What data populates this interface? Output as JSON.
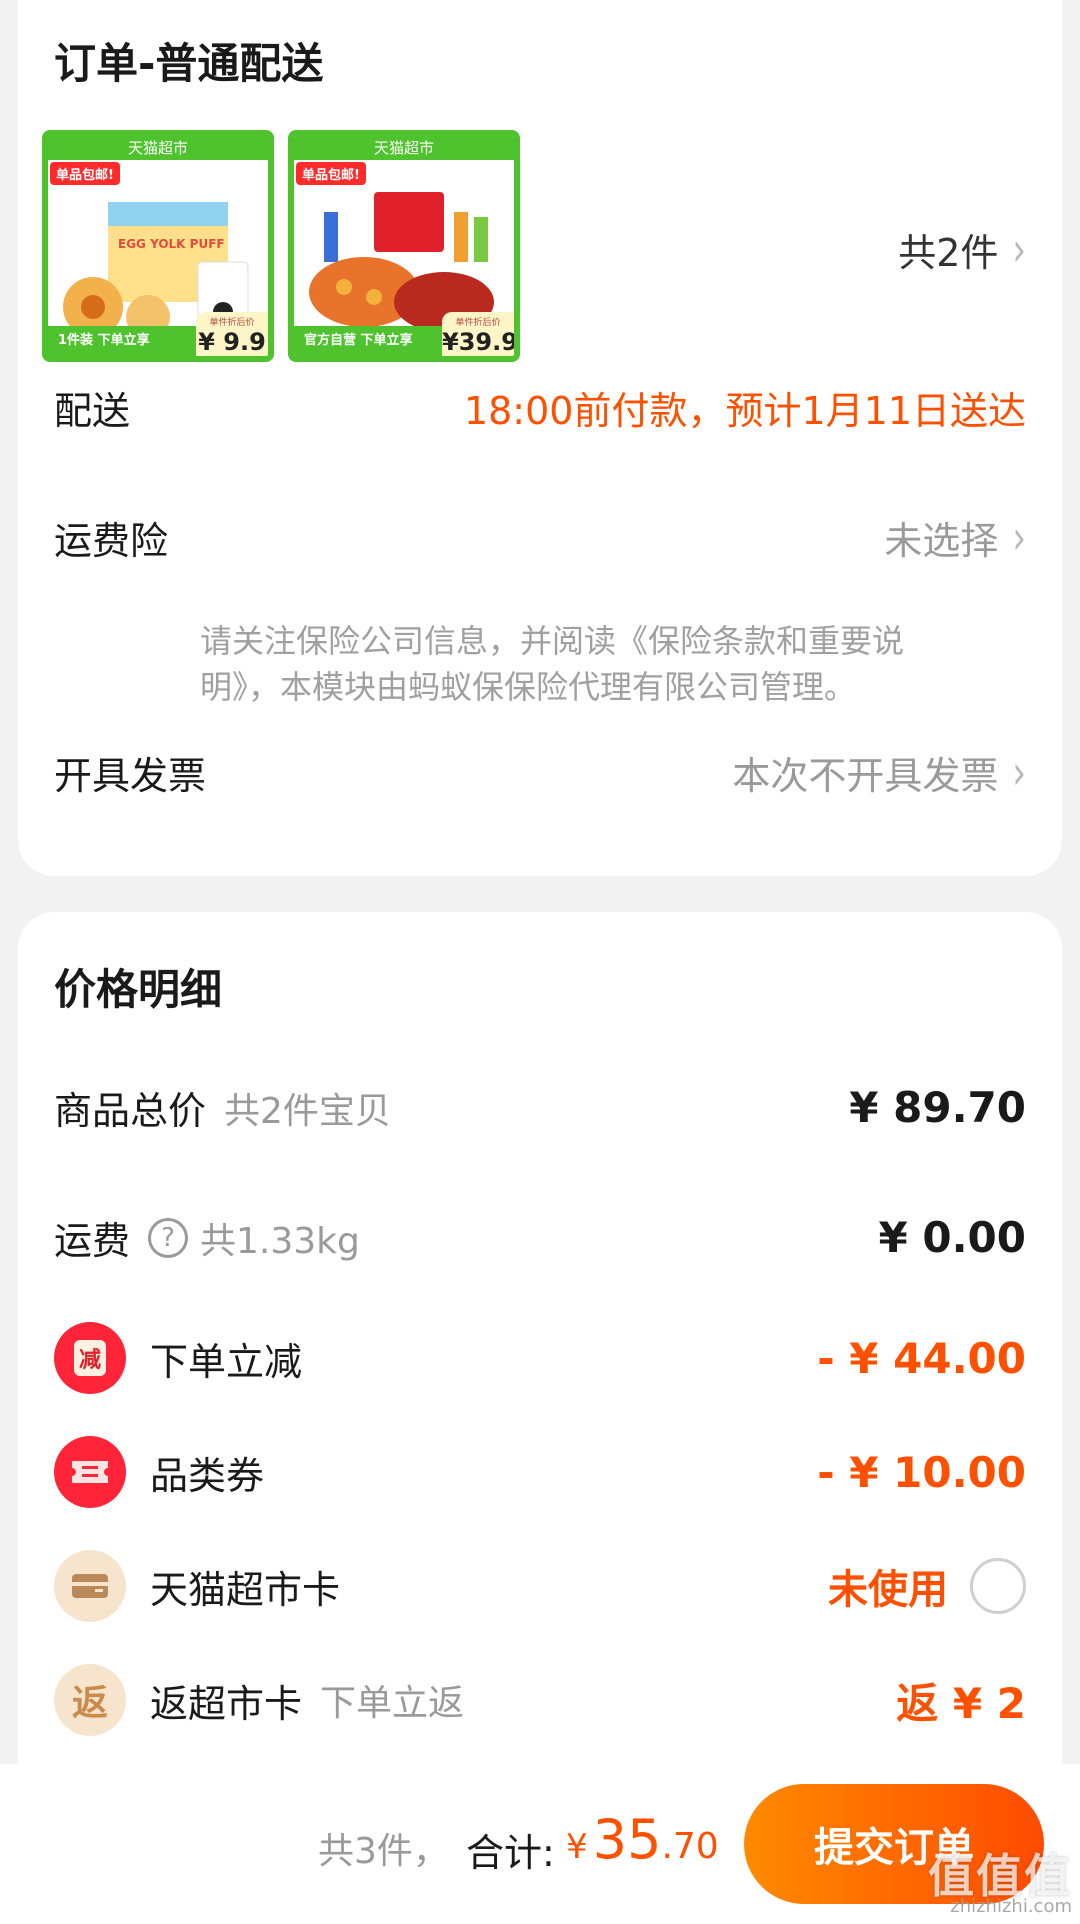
{
  "order": {
    "title": "订单-普通配送",
    "products": [
      {
        "banner": "天猫超市",
        "tag": "单品包邮!",
        "bottom_text": "1件装  下单立享",
        "price_label": "单件折后价",
        "price": "¥ 9.9",
        "art_text": "EGG YOLK PUFF"
      },
      {
        "banner": "天猫超市",
        "tag": "单品包邮!",
        "bottom_text": "官方自营  下单立享",
        "price_label": "单件折后价",
        "price": "¥39.9"
      }
    ],
    "item_count": "共2件",
    "delivery_label": "配送",
    "delivery_value": "18:00前付款，预计1月11日送达",
    "insurance_label": "运费险",
    "insurance_value": "未选择",
    "insurance_notice": "请关注保险公司信息，并阅读《保险条款和重要说明》，本模块由蚂蚁保保险代理有限公司管理。",
    "invoice_label": "开具发票",
    "invoice_value": "本次不开具发票"
  },
  "price": {
    "title": "价格明细",
    "goods_label": "商品总价",
    "goods_sub": "共2件宝贝",
    "goods_value": "¥ 89.70",
    "shipping_label": "运费",
    "shipping_help": "?",
    "shipping_sub": "共1.33kg",
    "shipping_value": "¥ 0.00",
    "discount_label": "下单立减",
    "discount_icon_char": "减",
    "discount_value": "- ¥ 44.00",
    "coupon_label": "品类券",
    "coupon_value": "- ¥ 10.00",
    "card_label": "天猫超市卡",
    "card_value": "未使用",
    "rebate_label": "返超市卡",
    "rebate_icon_char": "返",
    "rebate_sub": "下单立返",
    "rebate_value": "返 ¥ 2"
  },
  "bottom_bar": {
    "count": "共3件，",
    "total_label": "合计:",
    "currency": "¥",
    "total_int": "35",
    "total_dec": ".70",
    "submit_label": "提交订单",
    "watermark": "值值值",
    "watermark_url": "zhizhizhi.com"
  },
  "colors": {
    "accent": "#ff5000",
    "green": "#4fc32e",
    "red_icon": "#ff2438",
    "beige_icon": "#f7e4cc"
  }
}
